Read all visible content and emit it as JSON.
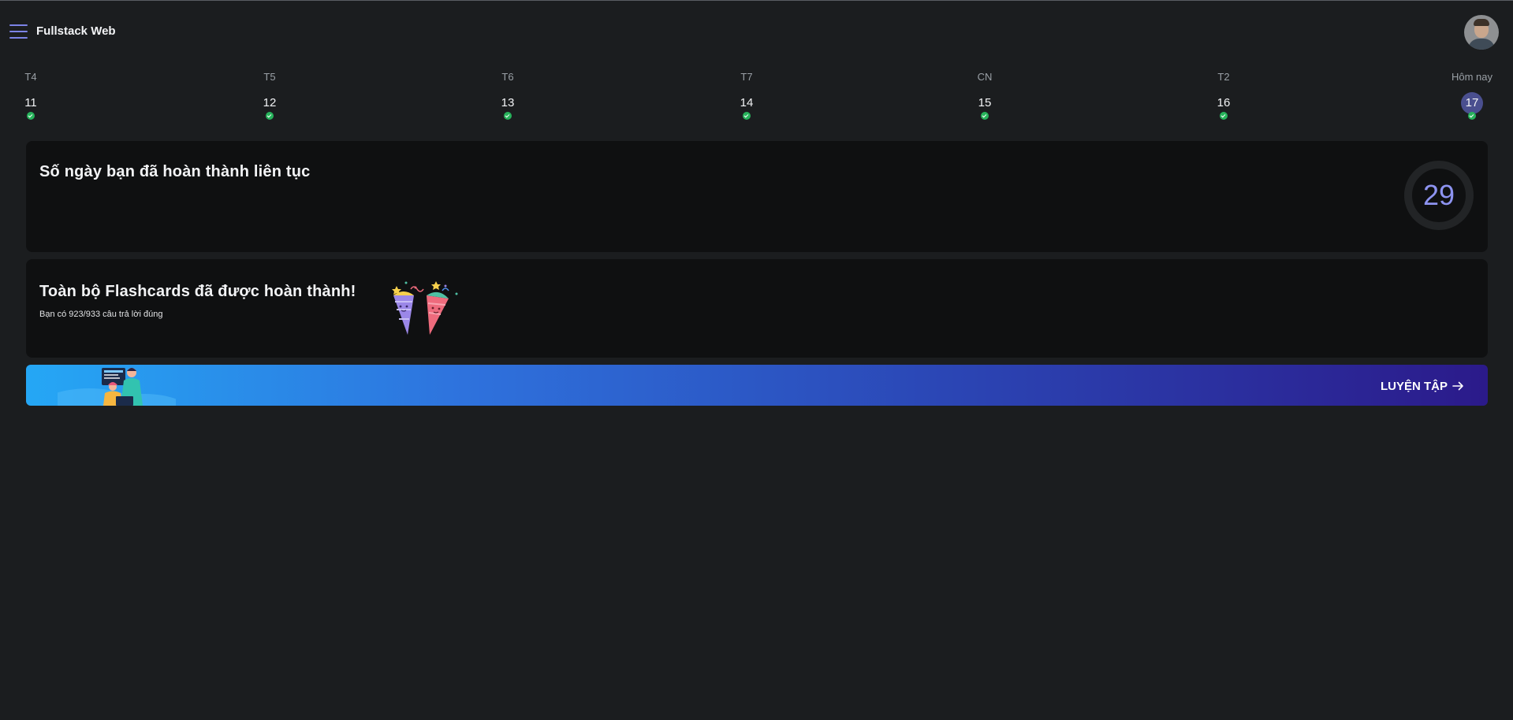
{
  "header": {
    "app_title": "Fullstack Web",
    "menu_icon": "hamburger-menu-icon",
    "avatar_icon": "user-avatar"
  },
  "week": {
    "days": [
      {
        "dow": "T4",
        "date": "11",
        "completed": true,
        "today": false
      },
      {
        "dow": "T5",
        "date": "12",
        "completed": true,
        "today": false
      },
      {
        "dow": "T6",
        "date": "13",
        "completed": true,
        "today": false
      },
      {
        "dow": "T7",
        "date": "14",
        "completed": true,
        "today": false
      },
      {
        "dow": "CN",
        "date": "15",
        "completed": true,
        "today": false
      },
      {
        "dow": "T2",
        "date": "16",
        "completed": true,
        "today": false
      },
      {
        "dow": "Hôm nay",
        "date": "17",
        "completed": true,
        "today": true
      }
    ]
  },
  "streak": {
    "title": "Số ngày bạn đã hoàn thành liên tục",
    "count": "29"
  },
  "flashcards": {
    "title": "Toàn bộ Flashcards đã được hoàn thành!",
    "subtitle": "Bạn có 923/933 câu trả lời đúng"
  },
  "practice": {
    "button_label": "LUYỆN TẬP"
  },
  "colors": {
    "background": "#1b1d1f",
    "card": "#0f1011",
    "accent": "#7c83e6",
    "check": "#27b35b",
    "banner_start": "#25a7f5",
    "banner_end": "#2b1a8a"
  }
}
